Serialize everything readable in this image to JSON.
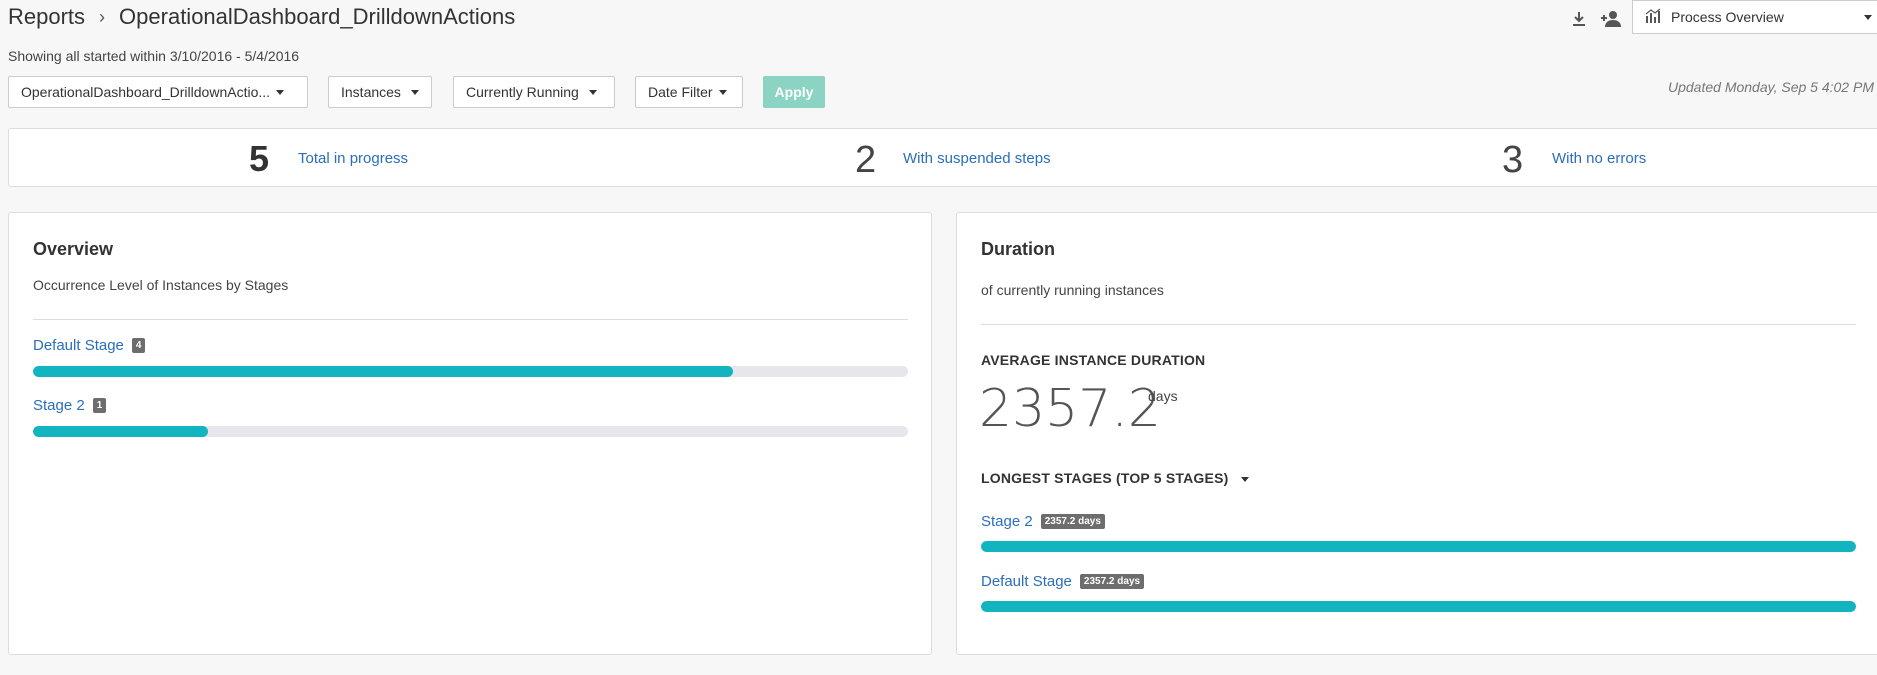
{
  "breadcrumb": {
    "root": "Reports",
    "current": "OperationalDashboard_DrilldownActions"
  },
  "range_text": "Showing all started within 3/10/2016 - 5/4/2016",
  "header": {
    "view_select": "Process Overview",
    "icons": [
      "download-icon",
      "add-user-icon",
      "chart-icon"
    ]
  },
  "filters": {
    "process": "OperationalDashboard_DrilldownActio...",
    "type": "Instances",
    "state": "Currently Running",
    "date": "Date Filter",
    "apply": "Apply"
  },
  "updated": "Updated Monday, Sep 5 4:02 PM",
  "summary": [
    {
      "value": "5",
      "label": "Total in progress"
    },
    {
      "value": "2",
      "label": "With suspended steps"
    },
    {
      "value": "3",
      "label": "With no errors"
    }
  ],
  "overview": {
    "title": "Overview",
    "subtitle": "Occurrence Level of Instances by Stages",
    "stages": [
      {
        "name": "Default Stage",
        "count": "4",
        "level": 0.8
      },
      {
        "name": "Stage 2",
        "count": "1",
        "level": 0.2
      }
    ]
  },
  "duration": {
    "title": "Duration",
    "subtitle": "of currently running instances",
    "avg_label": "AVERAGE INSTANCE DURATION",
    "avg_value": "2357.2",
    "avg_unit": "days",
    "longest_label": "LONGEST STAGES (TOP 5 STAGES)",
    "stages": [
      {
        "name": "Stage 2",
        "duration": "2357.2 days",
        "level": 1.0
      },
      {
        "name": "Default Stage",
        "duration": "2357.2 days",
        "level": 1.0
      }
    ]
  },
  "colors": {
    "accent": "#12b5bf",
    "link": "#2a6ebb",
    "apply": "#8bd3c3",
    "badge": "#6d6d6d"
  }
}
